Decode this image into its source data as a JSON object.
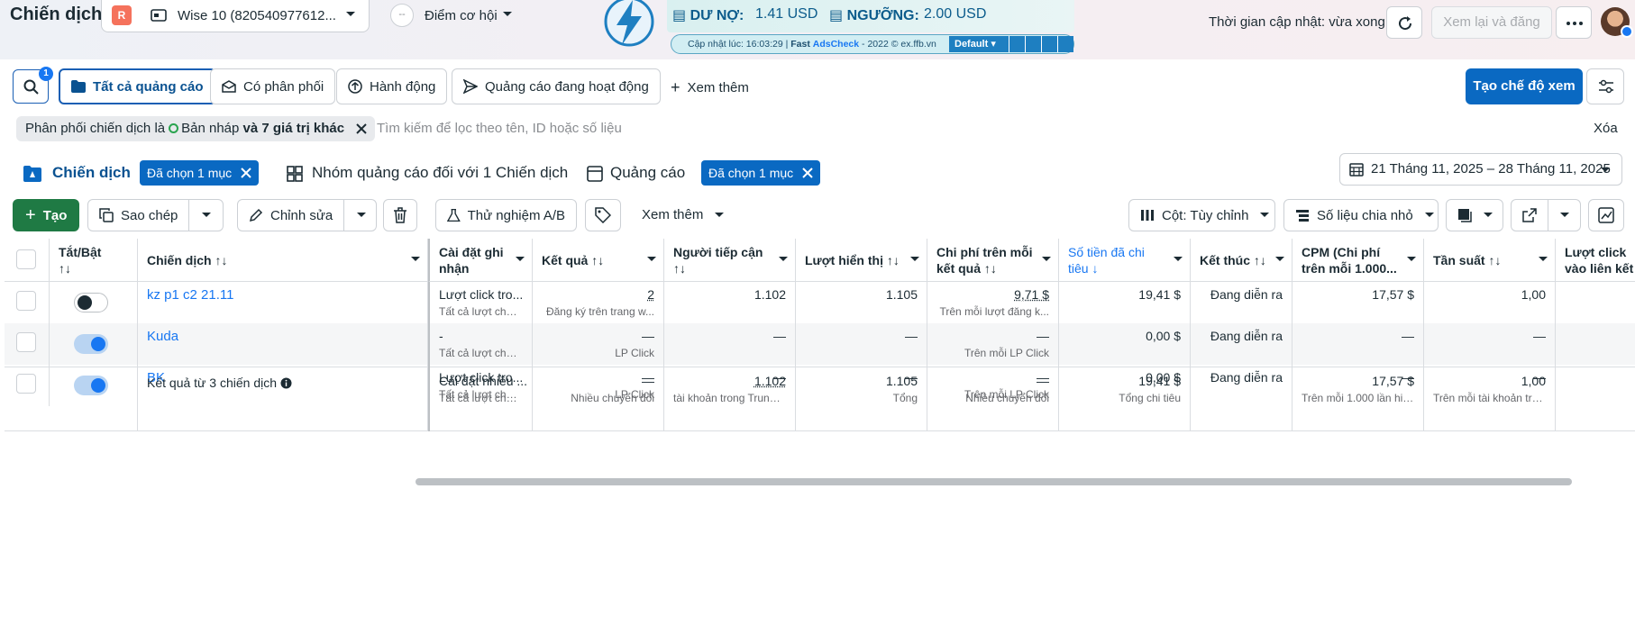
{
  "header": {
    "title": "Chiến dịch",
    "account": {
      "badge": "R",
      "name": "Wise 10 (820540977612..."
    },
    "opportunity": {
      "icon_text": "--",
      "label": "Điểm cơ hội"
    },
    "extension": {
      "debt_label": "DƯ NỢ:",
      "debt_value": "1.41 USD",
      "threshold_label": "NGƯỠNG:",
      "threshold_value": "2.00 USD",
      "updated": "Cập nhật lúc: 16:03:29 |",
      "brand_fast": "Fast",
      "brand_name": "AdsCheck",
      "brand_rest": "- 2022 © ex.ffb.vn",
      "select_value": "Default"
    },
    "update_time": "Thời gian cập nhật: vừa xong",
    "review_button": "Xem lại và đăng"
  },
  "filters": {
    "search_badge": "1",
    "tabs": [
      "Tất cả quảng cáo",
      "Có phân phối",
      "Hành động",
      "Quảng cáo đang hoạt động"
    ],
    "more": "Xem thêm",
    "create_view": "Tạo chế độ xem"
  },
  "filter_bar": {
    "chip_prefix": "Phân phối chiến dịch là",
    "chip_value": "Bản nháp",
    "chip_suffix": "và 7 giá trị khác",
    "search_placeholder": "Tìm kiếm để lọc theo tên, ID hoặc số liệu",
    "clear": "Xóa"
  },
  "level_tabs": {
    "campaigns": "Chiến dịch",
    "campaigns_pill": "Đã chọn 1 mục",
    "adsets": "Nhóm quảng cáo đối với 1 Chiến dịch",
    "ads": "Quảng cáo",
    "ads_pill": "Đã chọn 1 mục"
  },
  "date_range": "21 Tháng 11, 2025 – 28 Tháng 11, 2025",
  "toolbar": {
    "create": "Tạo",
    "duplicate": "Sao chép",
    "edit": "Chỉnh sửa",
    "ab_test": "Thử nghiệm A/B",
    "more": "Xem thêm",
    "columns": "Cột: Tùy chỉnh",
    "breakdown": "Số liệu chia nhỏ"
  },
  "table": {
    "headers": {
      "toggle": "Tắt/Bật",
      "name": "Chiến dịch",
      "attribution": "Cài đặt ghi nhận",
      "results": "Kết quả",
      "reach": "Người tiếp cận",
      "impressions": "Lượt hiển thị",
      "cost_per_result": "Chi phí trên mỗi kết quả",
      "amount_spent": "Số tiền đã chi tiêu",
      "ends": "Kết thúc",
      "cpm": "CPM (Chi phí trên mỗi 1.000...",
      "frequency": "Tần suất",
      "link_clicks": "Lượt click vào liên kết"
    },
    "rows": [
      {
        "name": "kz p1 c2 21.11",
        "attribution": "Lượt click tro...",
        "attribution_sub": "Tất cả lượt chuyể...",
        "results": "2",
        "results_sub": "Đăng ký trên trang w...",
        "reach": "1.102",
        "impressions": "1.105",
        "cost_per_result": "9,71 $",
        "cost_sub": "Trên mỗi lượt đăng k...",
        "amount_spent": "19,41 $",
        "ends": "Đang diễn ra",
        "cpm": "17,57 $",
        "frequency": "1,00",
        "toggle": "off"
      },
      {
        "name": "Kuda",
        "attribution": "-",
        "attribution_sub": "Tất cả lượt chuyể...",
        "results": "—",
        "results_sub": "LP Click",
        "reach": "—",
        "impressions": "—",
        "cost_per_result": "—",
        "cost_sub": "Trên mỗi LP Click",
        "amount_spent": "0,00 $",
        "ends": "Đang diễn ra",
        "cpm": "—",
        "frequency": "—",
        "toggle": "on"
      },
      {
        "name": "BK",
        "attribution": "Lượt click tro...",
        "attribution_sub": "Tất cả lượt chuyể...",
        "results": "—",
        "results_sub": "LP Click",
        "reach": "—",
        "impressions": "—",
        "cost_per_result": "—",
        "cost_sub": "Trên mỗi LP Click",
        "amount_spent": "0,00 $",
        "ends": "Đang diễn ra",
        "cpm": "—",
        "frequency": "—",
        "toggle": "on"
      }
    ],
    "summary": {
      "label": "Kết quả từ 3 chiến dịch",
      "attribution": "Cài đặt nhiều ...",
      "attribution_sub": "Tất cả lượt chuyể...",
      "results": "—",
      "results_sub": "Nhiều chuyển đổi",
      "reach": "1.102",
      "reach_sub": "tài khoản trong Trung ...",
      "impressions": "1.105",
      "impressions_sub": "Tổng",
      "cost_per_result": "—",
      "cost_sub": "Nhiều chuyển đổi",
      "amount_spent": "19,41 $",
      "amount_sub": "Tổng chi tiêu",
      "cpm": "17,57 $",
      "cpm_sub": "Trên mỗi 1.000 lần hiể...",
      "frequency": "1,00",
      "frequency_sub": "Trên mỗi tài khoản tro..."
    }
  },
  "colors": {
    "primary": "#0a69c2",
    "create": "#1f7a44",
    "link": "#1877f2"
  }
}
